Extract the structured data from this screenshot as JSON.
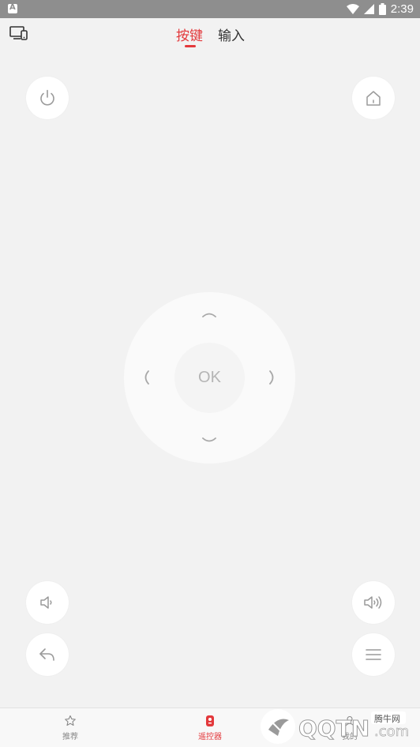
{
  "status_bar": {
    "time": "2:39",
    "battery_level_percent": 90
  },
  "top_bar": {
    "tabs": [
      {
        "label": "按键",
        "active": true
      },
      {
        "label": "输入",
        "active": false
      }
    ]
  },
  "remote": {
    "ok_label": "OK"
  },
  "bottom_nav": {
    "items": [
      {
        "label": "推荐",
        "icon": "star-icon",
        "active": false
      },
      {
        "label": "遥控器",
        "icon": "remote-icon",
        "active": true
      },
      {
        "label": "我的",
        "icon": "user-icon",
        "active": false
      }
    ]
  },
  "watermark": {
    "brand": "QQTN",
    "suffix": ".com",
    "tag": "腾牛网"
  },
  "colors": {
    "accent": "#e3393c",
    "background": "#f2f2f2",
    "status_bar": "#8e8e8e",
    "icon_gray": "#9a9a9a"
  }
}
